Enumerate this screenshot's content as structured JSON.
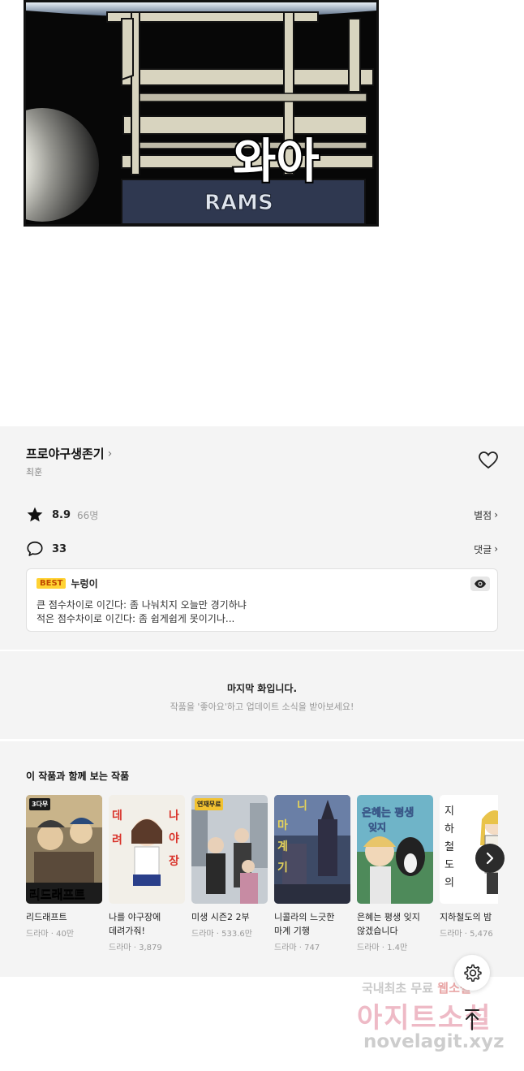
{
  "panel": {
    "sfx_text": "와아",
    "sign_text": "RAMS"
  },
  "work": {
    "title": "프로야구생존기",
    "author": "최훈",
    "rating": "8.9",
    "rating_count": "66명",
    "rating_link": "별점",
    "comment_count": "33",
    "comment_link": "댓글"
  },
  "best_comment": {
    "badge": "BEST",
    "user": "누렁이",
    "line1": "큰 점수차이로 이긴다: 좀 나눠치지 오늘만 경기하냐",
    "line2": "적은 점수차이로 이긴다: 좀 쉽게쉽게 못이기나..."
  },
  "last_episode": {
    "title": "마지막 화입니다.",
    "subtitle": "작품을 '좋아요'하고 업데이트 소식을 받아보세요!"
  },
  "recommendations": {
    "title": "이 작품과 함께 보는 작품",
    "items": [
      {
        "name": "리드래프트",
        "meta": "드라마 · 40만",
        "badge": "3다무"
      },
      {
        "name": "나를 야구장에 데려가줘!",
        "meta": "드라마 · 3,879",
        "badge": ""
      },
      {
        "name": "미생 시즌2 2부",
        "meta": "드라마 · 533.6만",
        "badge": "연재무료"
      },
      {
        "name": "니콜라의 느긋한 마계 기행",
        "meta": "드라마 · 747",
        "badge": ""
      },
      {
        "name": "은혜는 평생 잊지 않겠습니다",
        "meta": "드라마 · 1.4만",
        "badge": ""
      },
      {
        "name": "지하철도의 밤",
        "meta": "드라마 · 5,476",
        "badge": ""
      }
    ]
  },
  "watermark": {
    "line1": "국내최초 무료",
    "line1_accent": "웹소설",
    "line2": "아지트소설",
    "line3": "novelagit.xyz"
  },
  "colors": {
    "best_badge": "#ffd233",
    "section_bg": "#f4f4f4"
  },
  "icons": [
    "heart-icon",
    "star-icon",
    "comment-icon",
    "eye-icon",
    "chevron-right-icon",
    "gear-icon",
    "arrow-up-icon"
  ]
}
